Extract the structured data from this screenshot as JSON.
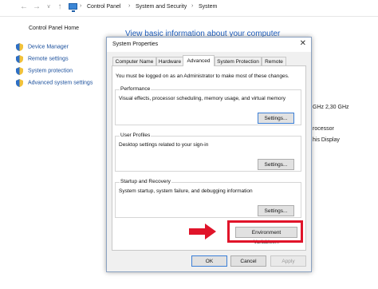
{
  "addressbar": {
    "breadcrumbs": [
      "Control Panel",
      "System and Security",
      "System"
    ]
  },
  "sidebar": {
    "home_label": "Control Panel Home",
    "items": [
      {
        "label": "Device Manager"
      },
      {
        "label": "Remote settings"
      },
      {
        "label": "System protection"
      },
      {
        "label": "Advanced system settings"
      }
    ]
  },
  "main": {
    "title": "View basic information about your computer",
    "partial_text": [
      "GHz  2,30 GHz",
      "rocessor",
      "his Display"
    ]
  },
  "dialog": {
    "title": "System Properties",
    "close_glyph": "✕",
    "tabs": [
      {
        "label": "Computer Name",
        "active": false
      },
      {
        "label": "Hardware",
        "active": false
      },
      {
        "label": "Advanced",
        "active": true
      },
      {
        "label": "System Protection",
        "active": false
      },
      {
        "label": "Remote",
        "active": false
      }
    ],
    "admin_note": "You must be logged on as an Administrator to make most of these changes.",
    "groups": [
      {
        "title": "Performance",
        "description": "Visual effects, processor scheduling, memory usage, and virtual memory",
        "button": "Settings..."
      },
      {
        "title": "User Profiles",
        "description": "Desktop settings related to your sign-in",
        "button": "Settings..."
      },
      {
        "title": "Startup and Recovery",
        "description": "System startup, system failure, and debugging information",
        "button": "Settings..."
      }
    ],
    "env_button": "Environment Variables...",
    "ok": "OK",
    "cancel": "Cancel",
    "apply": "Apply"
  },
  "colors": {
    "highlight": "#e0142a",
    "link": "#1a4f9c",
    "title_blue": "#1f5fbf"
  },
  "icons": [
    "back-arrow",
    "forward-arrow",
    "up-arrow",
    "computer",
    "shield",
    "close",
    "red-arrow"
  ]
}
